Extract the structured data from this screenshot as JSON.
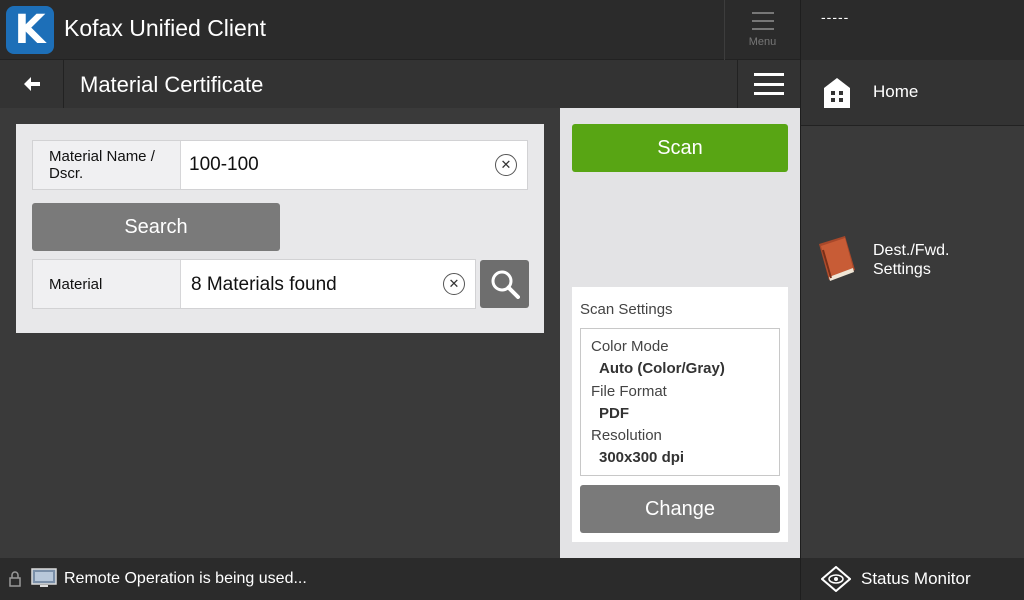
{
  "app": {
    "logo_letter": "K",
    "title": "Kofax Unified Client"
  },
  "menu": {
    "label": "Menu"
  },
  "user": {
    "name": "-----"
  },
  "page": {
    "title": "Material Certificate"
  },
  "form": {
    "material_name": {
      "label": "Material Name / Dscr.",
      "value": "100-100"
    },
    "search_label": "Search",
    "material": {
      "label": "Material",
      "value": "8 Materials found"
    }
  },
  "scan": {
    "label": "Scan",
    "settings_title": "Scan Settings",
    "settings": [
      {
        "key": "Color Mode",
        "value": "Auto (Color/Gray)"
      },
      {
        "key": "File Format",
        "value": "PDF"
      },
      {
        "key": "Resolution",
        "value": "300x300 dpi"
      }
    ],
    "change_label": "Change"
  },
  "nav": {
    "home": "Home",
    "dest_line1": "Dest./Fwd.",
    "dest_line2": "Settings"
  },
  "status": {
    "message": "Remote Operation is being used...",
    "monitor": "Status Monitor"
  },
  "colors": {
    "accent_green": "#58a514",
    "logo_blue": "#1d6fb8"
  }
}
